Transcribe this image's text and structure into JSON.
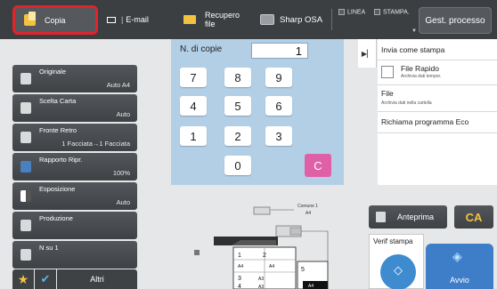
{
  "topbar": {
    "copy_label": "Copia",
    "email_label": "E-mail",
    "recupero_line1": "Recupero",
    "recupero_line2": "file",
    "osa_label": "Sharp OSA",
    "linea_label": "LINEA",
    "stampa_label": "STAMPA.",
    "gest_label": "Gest. processo"
  },
  "keypad": {
    "title": "N. di copie",
    "display_value": "1",
    "keys": [
      "7",
      "8",
      "9",
      "4",
      "5",
      "6",
      "1",
      "2",
      "3",
      "0"
    ],
    "clear_label": "C"
  },
  "left_menu": [
    {
      "label": "Originale",
      "value": "Auto A4",
      "icon": "original-icon"
    },
    {
      "label": "Scelta Carta",
      "value": "Auto",
      "icon": "paper-icon"
    },
    {
      "label": "Fronte Retro",
      "value": "1 Facciata→1 Facciata",
      "icon": "duplex-icon"
    },
    {
      "label": "Rapporto Ripr.",
      "value": "100%",
      "icon": "zoom-icon"
    },
    {
      "label": "Esposizione",
      "value": "Auto",
      "icon": "exposure-icon"
    },
    {
      "label": "Produzione",
      "value": "",
      "icon": "output-icon"
    },
    {
      "label": "N su 1",
      "value": "",
      "icon": "n-up-icon"
    }
  ],
  "bottom_left": {
    "altri_label": "Altri"
  },
  "right_panel": {
    "invia_label": "Invia come stampa",
    "file_rapido_label": "File Rapido",
    "file_rapido_sub": "Archivia dati tempor.",
    "file_label": "File",
    "file_sub": "Archivia dati nella cartella",
    "richiama_label": "Richiama programma Eco"
  },
  "machine": {
    "comune_label": "Comune 1",
    "comune_size": "A4",
    "tray1": "1",
    "tray2": "2",
    "tray3": "3",
    "tray4": "4",
    "tray5": "5",
    "size_a4_1": "A4",
    "size_a4_2": "A4",
    "size_a3_1": "A3",
    "size_a3_2": "A3",
    "size_a4_3": "A4"
  },
  "actions": {
    "anteprima_label": "Anteprima",
    "ca_label": "CA",
    "verif_label": "Verif stampa",
    "avvio_label": "Avvio"
  },
  "colors": {
    "highlight_border": "#e0242b",
    "keypad_bg": "#b3cfe6",
    "clear_key": "#e060a8",
    "start_button": "#3e7dc8"
  }
}
